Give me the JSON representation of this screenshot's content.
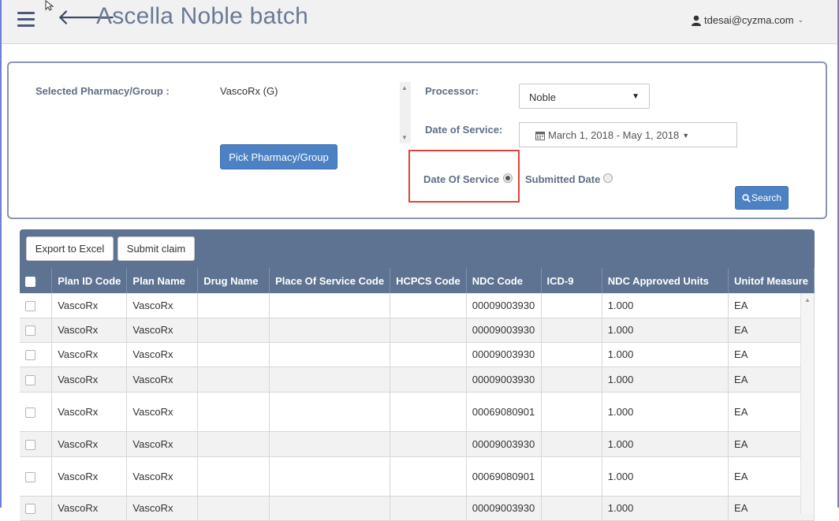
{
  "header": {
    "title": "Ascella Noble batch",
    "user": "tdesai@cyzma.com"
  },
  "filter": {
    "pharmacy_label": "Selected Pharmacy/Group :",
    "pharmacy_value": "VascoRx (G)",
    "pick_button": "Pick Pharmacy/Group",
    "processor_label": "Processor:",
    "processor_value": "Noble",
    "dos_label": "Date of Service:",
    "date_range": "March 1, 2018 - May 1, 2018",
    "radio_dos_label": "Date Of Service",
    "radio_submitted_label": "Submitted Date",
    "radio_selected": "Date Of Service",
    "search_button": "Search"
  },
  "grid": {
    "export_button": "Export to Excel",
    "submit_button": "Submit claim",
    "columns": [
      "Plan ID Code",
      "Plan Name",
      "Drug Name",
      "Place Of Service Code",
      "HCPCS Code",
      "NDC Code",
      "ICD-9",
      "NDC Approved Units",
      "Unitof Measure"
    ],
    "rows": [
      {
        "plan_id": "VascoRx",
        "plan_name": "VascoRx",
        "drug": "",
        "pos": "",
        "hcpcs": "",
        "ndc": "00009003930",
        "icd": "",
        "units": "1.000",
        "uom": "EA"
      },
      {
        "plan_id": "VascoRx",
        "plan_name": "VascoRx",
        "drug": "",
        "pos": "",
        "hcpcs": "",
        "ndc": "00009003930",
        "icd": "",
        "units": "1.000",
        "uom": "EA"
      },
      {
        "plan_id": "VascoRx",
        "plan_name": "VascoRx",
        "drug": "",
        "pos": "",
        "hcpcs": "",
        "ndc": "00009003930",
        "icd": "",
        "units": "1.000",
        "uom": "EA"
      },
      {
        "plan_id": "VascoRx",
        "plan_name": "VascoRx",
        "drug": "",
        "pos": "",
        "hcpcs": "",
        "ndc": "00009003930",
        "icd": "",
        "units": "1.000",
        "uom": "EA"
      },
      {
        "plan_id": "VascoRx",
        "plan_name": "VascoRx",
        "drug": "",
        "pos": "",
        "hcpcs": "",
        "ndc": "00069080901",
        "icd": "",
        "units": "1.000",
        "uom": "EA"
      },
      {
        "plan_id": "VascoRx",
        "plan_name": "VascoRx",
        "drug": "",
        "pos": "",
        "hcpcs": "",
        "ndc": "00009003930",
        "icd": "",
        "units": "1.000",
        "uom": "EA"
      },
      {
        "plan_id": "VascoRx",
        "plan_name": "VascoRx",
        "drug": "",
        "pos": "",
        "hcpcs": "",
        "ndc": "00069080901",
        "icd": "",
        "units": "1.000",
        "uom": "EA"
      },
      {
        "plan_id": "VascoRx",
        "plan_name": "VascoRx",
        "drug": "",
        "pos": "",
        "hcpcs": "",
        "ndc": "00009003930",
        "icd": "",
        "units": "1.000",
        "uom": "EA"
      }
    ]
  }
}
